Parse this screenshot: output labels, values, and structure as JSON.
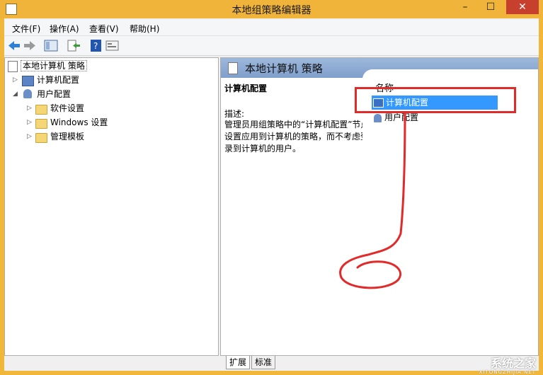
{
  "window": {
    "title": "本地组策略编辑器",
    "minimize": "–",
    "maximize": "☐",
    "close": "✕"
  },
  "menu": [
    "文件(F)",
    "操作(A)",
    "查看(V)",
    "帮助(H)"
  ],
  "tree": {
    "root": "本地计算机 策略",
    "computer": "计算机配置",
    "user": "用户配置",
    "children": [
      "软件设置",
      "Windows 设置",
      "管理模板"
    ]
  },
  "right": {
    "header_title": "本地计算机 策略",
    "desc_title": "计算机配置",
    "desc_label": "描述:",
    "desc_text": "管理员用组策略中的“计算机配置”节点设置应用到计算机的策略，而不考虑登录到计算机的用户。",
    "column_name": "名称",
    "items": [
      "计算机配置",
      "用户配置"
    ]
  },
  "tabs": [
    "扩展",
    "标准"
  ],
  "watermark": {
    "main": "系统之家",
    "sub": "XITONGZHIJIA.NET"
  },
  "colors": {
    "titlebar": "#f1b43a",
    "selection": "#3399ff",
    "annotation": "#e12a2a"
  }
}
